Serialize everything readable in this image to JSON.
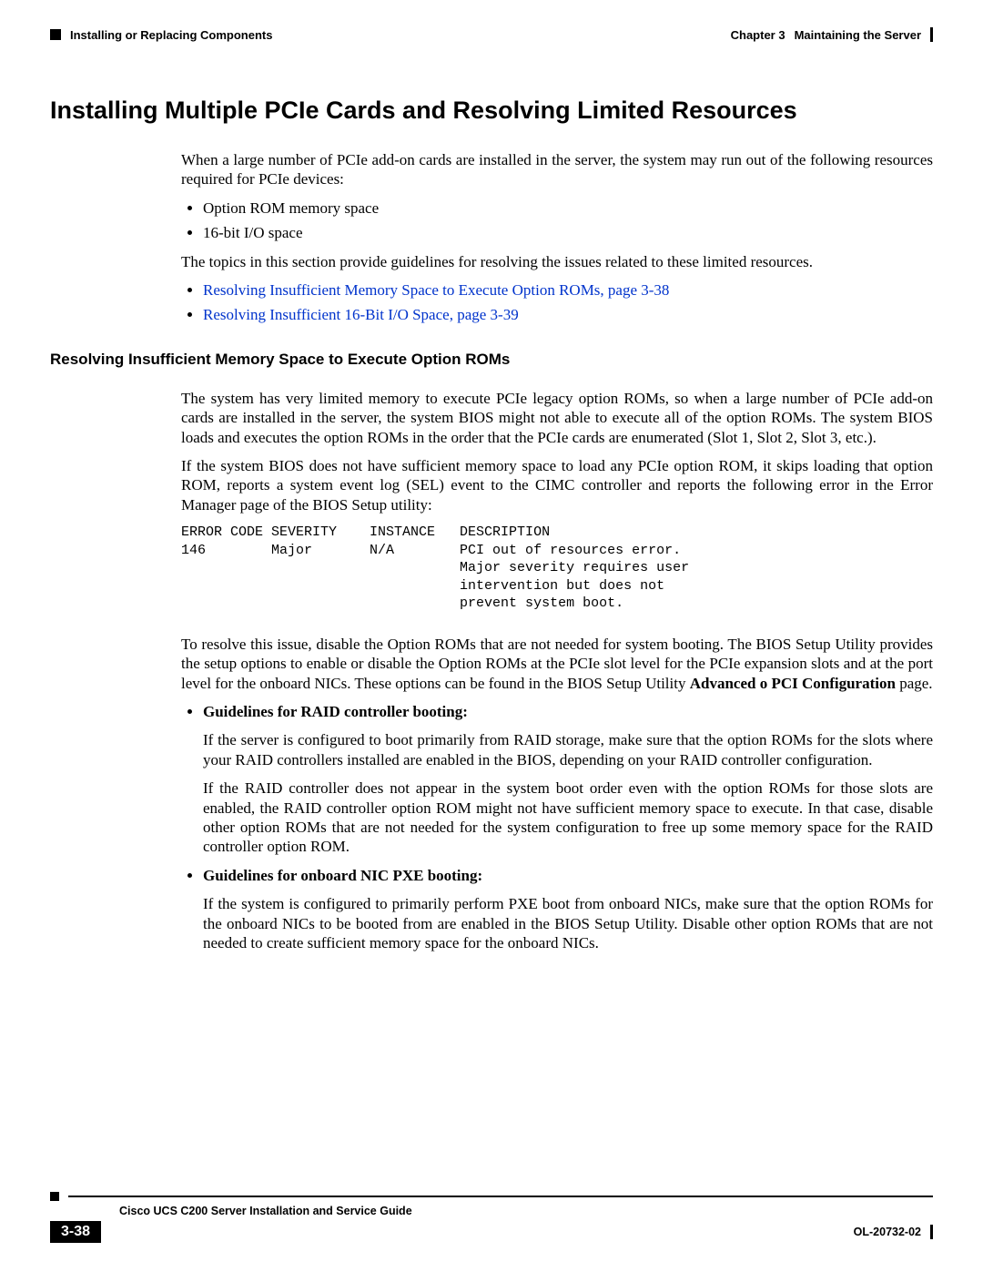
{
  "header": {
    "left_section": "Installing or Replacing Components",
    "right_chapter": "Chapter 3",
    "right_title": "Maintaining the Server"
  },
  "h1": "Installing Multiple PCIe Cards and Resolving Limited Resources",
  "intro": {
    "p1": "When a large number of PCIe add-on cards are installed in the server, the system may run out of the following resources required for PCIe devices:",
    "b1": "Option ROM memory space",
    "b2": "16-bit I/O space",
    "p2": "The topics in this section provide guidelines for resolving the issues related to these limited resources.",
    "link1": "Resolving Insufficient Memory Space to Execute Option ROMs, page 3-38",
    "link2": "Resolving Insufficient 16-Bit I/O Space, page 3-39"
  },
  "h2": "Resolving Insufficient Memory Space to Execute Option ROMs",
  "sec": {
    "p1": "The system has very limited memory to execute PCIe legacy option ROMs, so when a large number of PCIe add-on cards are installed in the server, the system BIOS might not able to execute all of the option ROMs. The system BIOS loads and executes the option ROMs in the order that the PCIe cards are enumerated (Slot 1, Slot 2, Slot 3, etc.).",
    "p2": "If the system BIOS does not have sufficient memory space to load any PCIe option ROM, it skips loading that option ROM, reports a system event log (SEL) event to the CIMC controller and reports the following error in the Error Manager page of the BIOS Setup utility:",
    "code": "ERROR CODE SEVERITY    INSTANCE   DESCRIPTION\n146        Major       N/A        PCI out of resources error.\n                                  Major severity requires user\n                                  intervention but does not\n                                  prevent system boot.",
    "p3a": "To resolve this issue, disable the Option ROMs that are not needed for system booting. The BIOS Setup Utility provides the setup options to enable or disable the Option ROMs at the PCIe slot level for the PCIe expansion slots and at the port level for the onboard NICs. These options can be found in the BIOS Setup Utility ",
    "p3b": "Advanced",
    "p3c": " o ",
    "p3d": "PCI Configuration",
    "p3e": " page.",
    "bl1": "Guidelines for RAID controller booting:",
    "bl1p1": "If the server is configured to boot primarily from RAID storage, make sure that the option ROMs for the slots where your RAID controllers installed are enabled in the BIOS, depending on your RAID controller configuration.",
    "bl1p2": "If the RAID controller does not appear in the system boot order even with the option ROMs for those slots are enabled, the RAID controller option ROM might not have sufficient memory space to execute. In that case, disable other option ROMs that are not needed for the system configuration to free up some memory space for the RAID controller option ROM.",
    "bl2": "Guidelines for onboard NIC PXE booting:",
    "bl2p1": "If the system is configured to primarily perform PXE boot from onboard NICs, make sure that the option ROMs for the onboard NICs to be booted from are enabled in the BIOS Setup Utility. Disable other option ROMs that are not needed to create sufficient memory space for the onboard NICs."
  },
  "footer": {
    "guide": "Cisco UCS C200 Server Installation and Service Guide",
    "page": "3-38",
    "docid": "OL-20732-02"
  }
}
